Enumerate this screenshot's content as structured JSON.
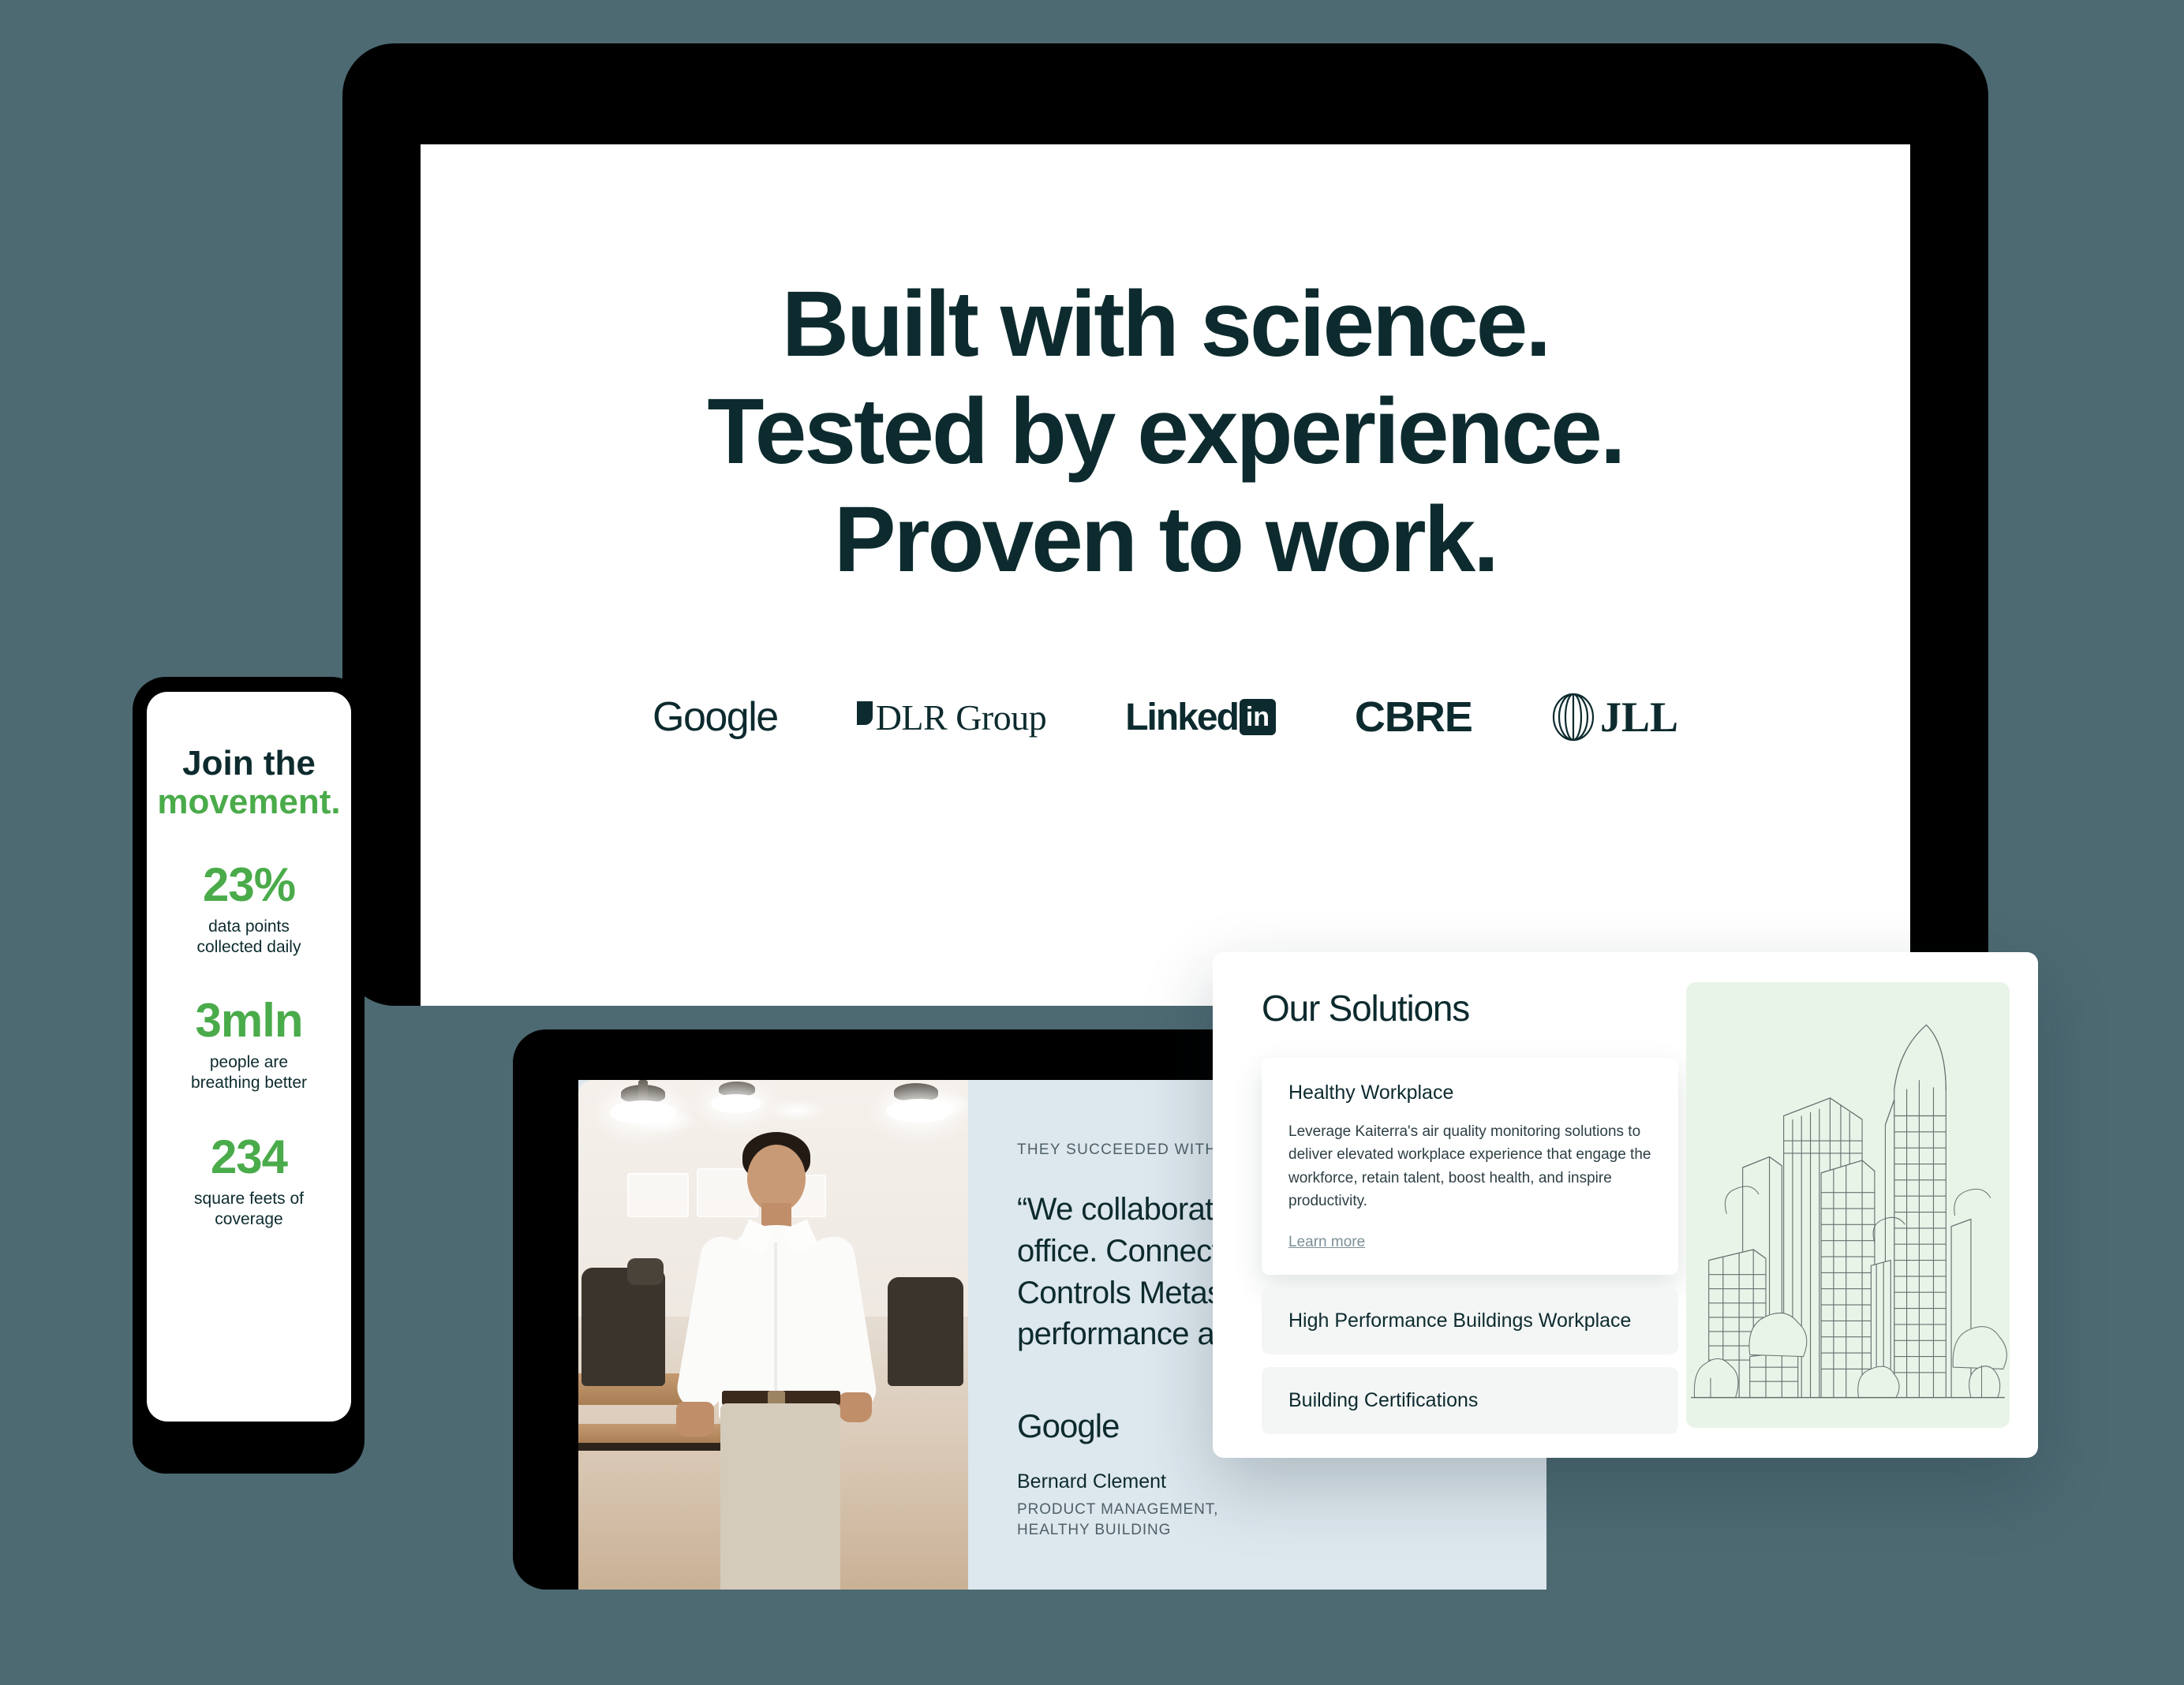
{
  "theme": {
    "page_background": "#4d6a73",
    "device_bezel": "#000000",
    "ink": "#0d2b2e",
    "accent_green": "#4aab4a",
    "muted": "#4e6068",
    "quote_panel": "#dde7ee",
    "illustration_background": "#e9f4e8",
    "closed_item_background": "#f4f6f6"
  },
  "hero": {
    "headline_lines": [
      "Built with science.",
      "Tested by experience.",
      "Proven to work."
    ],
    "logos": [
      {
        "name": "Google",
        "icon": "google-wordmark"
      },
      {
        "name": "DLR Group",
        "icon": "dlr-group-logo"
      },
      {
        "name": "Linked",
        "badge": "in",
        "icon": "linkedin-logo"
      },
      {
        "name": "CBRE",
        "icon": "cbre-wordmark"
      },
      {
        "name": "JLL",
        "icon": "jll-logo"
      }
    ]
  },
  "phone": {
    "title_line_1": "Join the",
    "title_line_2": "movement.",
    "stats": [
      {
        "value": "23%",
        "label_line_1": "data points",
        "label_line_2": "collected daily"
      },
      {
        "value": "3mln",
        "label_line_1": "people are",
        "label_line_2": "breathing better"
      },
      {
        "value": "234",
        "label_line_1": "square feets of",
        "label_line_2": "coverage"
      }
    ]
  },
  "story": {
    "eyebrow": "THEY SUCCEEDED WITH KAITERRA",
    "quote": "“We collaborated to improve IAQ in the office. Connecting Kaiterra with Controls Metasys helped improve performance and optimize energy.”",
    "brand": "Google",
    "person_name": "Bernard Clement",
    "person_role": "PRODUCT MANAGEMENT, HEALTHY BUILDING",
    "photo_alt": "Smiling man in white shirt leaning on a desk in an open office",
    "prev_arrow": "←",
    "next_arrow": "→",
    "prev_enabled": false,
    "next_enabled": true
  },
  "solutions": {
    "title": "Our Solutions",
    "items": [
      {
        "title": "Healthy Workplace",
        "body": "Leverage Kaiterra's air quality monitoring solutions to deliver elevated workplace experience that engage the workforce, retain talent, boost health, and inspire productivity.",
        "link": "Learn more",
        "expanded": true
      },
      {
        "title": "High Performance Buildings Workplace",
        "expanded": false
      },
      {
        "title": "Building Certifications",
        "expanded": false
      }
    ],
    "illustration_alt": "Line drawing of a city skyline with towers and trees"
  }
}
